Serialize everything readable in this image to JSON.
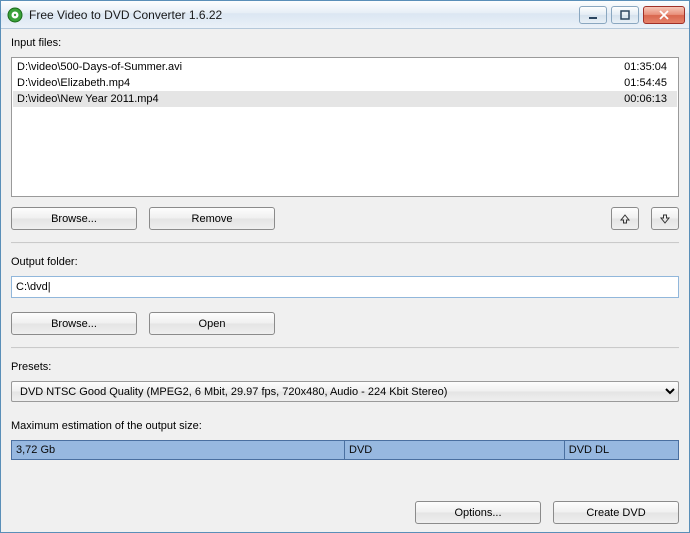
{
  "window": {
    "title": "Free Video to DVD Converter 1.6.22"
  },
  "input": {
    "label": "Input files:",
    "files": [
      {
        "path": "D:\\video\\500-Days-of-Summer.avi",
        "duration": "01:35:04",
        "selected": false
      },
      {
        "path": "D:\\video\\Elizabeth.mp4",
        "duration": "01:54:45",
        "selected": false
      },
      {
        "path": "D:\\video\\New Year 2011.mp4",
        "duration": "00:06:13",
        "selected": true
      }
    ],
    "browse_label": "Browse...",
    "remove_label": "Remove"
  },
  "output": {
    "label": "Output folder:",
    "value": "C:\\dvd|",
    "browse_label": "Browse...",
    "open_label": "Open"
  },
  "presets": {
    "label": "Presets:",
    "selected": "DVD NTSC Good Quality (MPEG2, 6 Mbit, 29.97 fps, 720x480, Audio - 224 Kbit Stereo)"
  },
  "size": {
    "label": "Maximum estimation of the output size:",
    "estimate": "3,72 Gb",
    "mark_dvd": "DVD",
    "mark_dvddl": "DVD DL"
  },
  "footer": {
    "options_label": "Options...",
    "create_label": "Create DVD"
  }
}
